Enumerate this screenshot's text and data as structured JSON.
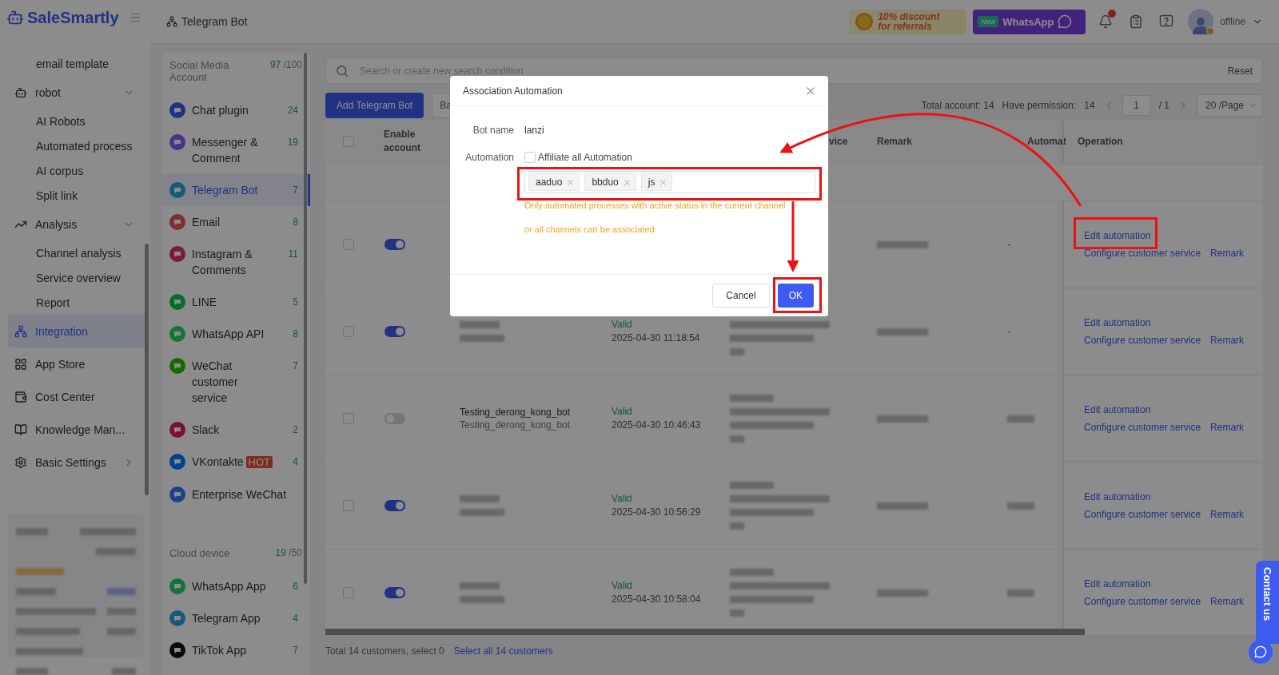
{
  "brand": {
    "name": "SaleSmartly"
  },
  "nav": [
    {
      "label": "email template",
      "kind": "sub",
      "selected": false
    },
    {
      "label": "robot",
      "kind": "group",
      "expanded": true,
      "selected": false
    },
    {
      "label": "AI Robots",
      "kind": "sub",
      "selected": false
    },
    {
      "label": "Automated process",
      "kind": "sub",
      "selected": false
    },
    {
      "label": "AI corpus",
      "kind": "sub",
      "selected": false
    },
    {
      "label": "Split link",
      "kind": "sub",
      "selected": false
    },
    {
      "label": "Analysis",
      "kind": "group",
      "expanded": true,
      "selected": false
    },
    {
      "label": "Channel analysis",
      "kind": "sub",
      "selected": false
    },
    {
      "label": "Service overview",
      "kind": "sub",
      "selected": false
    },
    {
      "label": "Report",
      "kind": "sub",
      "selected": false
    },
    {
      "label": "Integration",
      "kind": "top",
      "selected": true
    },
    {
      "label": "App Store",
      "kind": "top",
      "selected": false
    },
    {
      "label": "Cost Center",
      "kind": "top",
      "selected": false
    },
    {
      "label": "Knowledge Man...",
      "kind": "top",
      "selected": false
    },
    {
      "label": "Basic Settings",
      "kind": "group",
      "expanded": false,
      "selected": false
    }
  ],
  "header": {
    "breadcrumb": "Telegram Bot",
    "promo": {
      "title": "10% discount",
      "subtitle": "for referrals"
    },
    "whatsapp_banner": {
      "badge": "New",
      "label": "WhatsApp"
    },
    "notifications": {
      "unread": true
    },
    "user": {
      "status": "offline"
    }
  },
  "channels": {
    "sections": [
      {
        "title": "Social Media Account",
        "used": "97",
        "limit": "/100",
        "items": [
          {
            "name": "Chat plugin",
            "count": "24",
            "selected": false
          },
          {
            "name": "Messenger & Comment",
            "count": "19",
            "selected": false
          },
          {
            "name": "Telegram Bot",
            "count": "7",
            "selected": true
          },
          {
            "name": "Email",
            "count": "8",
            "selected": false
          },
          {
            "name": "Instagram & Comments",
            "count": "11",
            "selected": false
          },
          {
            "name": "LINE",
            "count": "5",
            "selected": false
          },
          {
            "name": "WhatsApp API",
            "count": "8",
            "selected": false
          },
          {
            "name": "WeChat customer service",
            "count": "7",
            "selected": false
          },
          {
            "name": "Slack",
            "count": "2",
            "selected": false
          },
          {
            "name": "VKontakte",
            "count": "4",
            "selected": false,
            "badge": "HOT"
          },
          {
            "name": "Enterprise WeChat",
            "selected": false
          }
        ]
      },
      {
        "title": "Cloud device",
        "used": "19",
        "limit": "/50",
        "items": [
          {
            "name": "WhatsApp App",
            "count": "6",
            "selected": false
          },
          {
            "name": "Telegram App",
            "count": "4",
            "selected": false
          },
          {
            "name": "TikTok App",
            "count": "7",
            "selected": false
          }
        ]
      }
    ]
  },
  "search": {
    "placeholder": "Search or create new search condition",
    "reset": "Reset"
  },
  "toolbar": {
    "buttons": [
      {
        "label": "Add Telegram Bot",
        "kind": "primary"
      },
      {
        "label": "Ba",
        "kind": "default"
      }
    ]
  },
  "pagination": {
    "total": "Total account: 14",
    "permission": "Have permission:",
    "permission_count": "14",
    "page": "1",
    "pages": "/ 1",
    "page_size": "20 /Page"
  },
  "table": {
    "all_checked": false,
    "columns": [
      {
        "label": "Enable account"
      },
      {
        "label": "vice"
      },
      {
        "label": "Remark"
      },
      {
        "label": "Automat"
      },
      {
        "label": "Operation"
      }
    ],
    "rows": [
      {
        "checked": false,
        "enabled": true,
        "automation": "-",
        "operations": [
          "Edit automation",
          "Configure customer service",
          "Remark"
        ]
      },
      {
        "checked": false,
        "enabled": true,
        "status": "Valid",
        "time": "2025-04-30 11:18:54",
        "automation": "-",
        "operations": [
          "Edit automation",
          "Configure customer service",
          "Remark"
        ]
      },
      {
        "checked": false,
        "enabled": false,
        "name": [
          "Testing_derong_kong_bot",
          "Testing_derong_kong_bot"
        ],
        "status": "Valid",
        "time": "2025-04-30 10:46:43",
        "operations": [
          "Edit automation",
          "Configure customer service",
          "Remark"
        ]
      },
      {
        "checked": false,
        "enabled": true,
        "status": "Valid",
        "time": "2025-04-30 10:56:29",
        "operations": [
          "Edit automation",
          "Configure customer service",
          "Remark"
        ]
      },
      {
        "checked": false,
        "enabled": true,
        "status": "Valid",
        "time": "2025-04-30 10:58:04",
        "operations": [
          "Edit automation",
          "Configure customer service",
          "Remark"
        ]
      }
    ]
  },
  "footer": {
    "summary": "Total 14 customers, select 0",
    "select_all": "Select all 14 customers"
  },
  "dialog": {
    "title": "Association Automation",
    "fields": [
      {
        "label": "Bot name",
        "kind": "text",
        "value": "lanzi"
      },
      {
        "label": "Automation",
        "kind": "automation",
        "checkbox": {
          "label": "Affiliate all Automation",
          "checked": false
        },
        "tags": [
          "aaduo",
          "bbduo",
          "js"
        ],
        "hint": "Only automated processes with active status in the current channel or all channels can be associated"
      }
    ],
    "buttons": [
      {
        "label": "Cancel",
        "kind": "default"
      },
      {
        "label": "OK",
        "kind": "primary"
      }
    ]
  },
  "contact": {
    "label": "Contact us"
  }
}
